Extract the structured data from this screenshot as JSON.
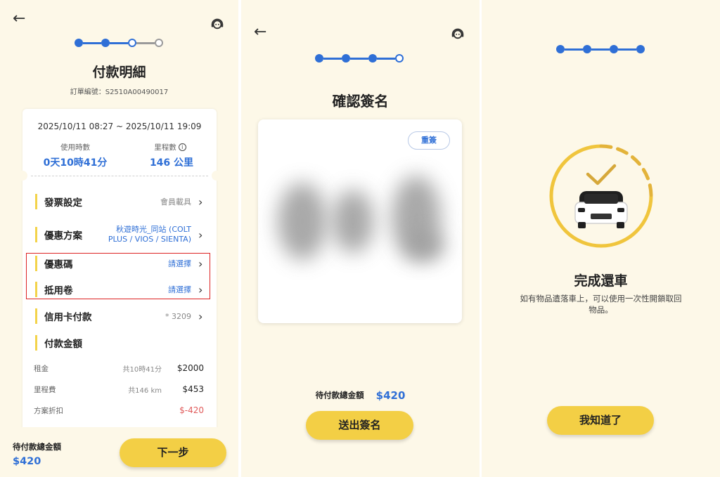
{
  "panel1": {
    "title": "付款明細",
    "order_label": "訂單編號：S2510A00490017",
    "date_range": "2025/10/11 08:27 ~ 2025/10/11 19:09",
    "usage_time_label": "使用時數",
    "usage_time_value": "0天10時41分",
    "mileage_label": "里程數",
    "mileage_value": "146 公里",
    "rows": [
      {
        "label": "發票設定",
        "value": "會員載具"
      },
      {
        "label": "優惠方案",
        "value_line1": "秋遊時光_同站 (COLT",
        "value_line2": "PLUS / VIOS / SIENTA)"
      },
      {
        "label": "優惠碼",
        "value": "請選擇"
      },
      {
        "label": "抵用卷",
        "value": "請選擇"
      },
      {
        "label": "信用卡付款",
        "value": "* 3209"
      },
      {
        "label": "付款金額"
      }
    ],
    "fees": [
      {
        "label": "租金",
        "detail": "共10時41分",
        "amount": "$2000"
      },
      {
        "label": "里程費",
        "detail": "共146 km",
        "amount": "$453"
      },
      {
        "label": "方案折扣",
        "detail": "",
        "amount": "$-420"
      }
    ],
    "footer_label": "待付款總金額",
    "footer_amount": "$420",
    "next_button": "下一步",
    "icons": [
      "back-arrow-icon",
      "support-agent-icon",
      "chevron-right-icon",
      "info-icon"
    ],
    "colors": {
      "accent": "#2f6fd6",
      "button": "#f3cf45",
      "background": "#fdf8e8",
      "discount": "#e05a5a"
    }
  },
  "panel2": {
    "title": "確認簽名",
    "resign_button": "重簽",
    "pending_label": "待付款總金額",
    "pending_amount": "$420",
    "submit_button": "送出簽名"
  },
  "panel3": {
    "title": "完成還車",
    "message_line1": "如有物品遺落車上，可以使用一次性開鎖取回",
    "message_line2": "物品。",
    "ok_button": "我知道了"
  }
}
